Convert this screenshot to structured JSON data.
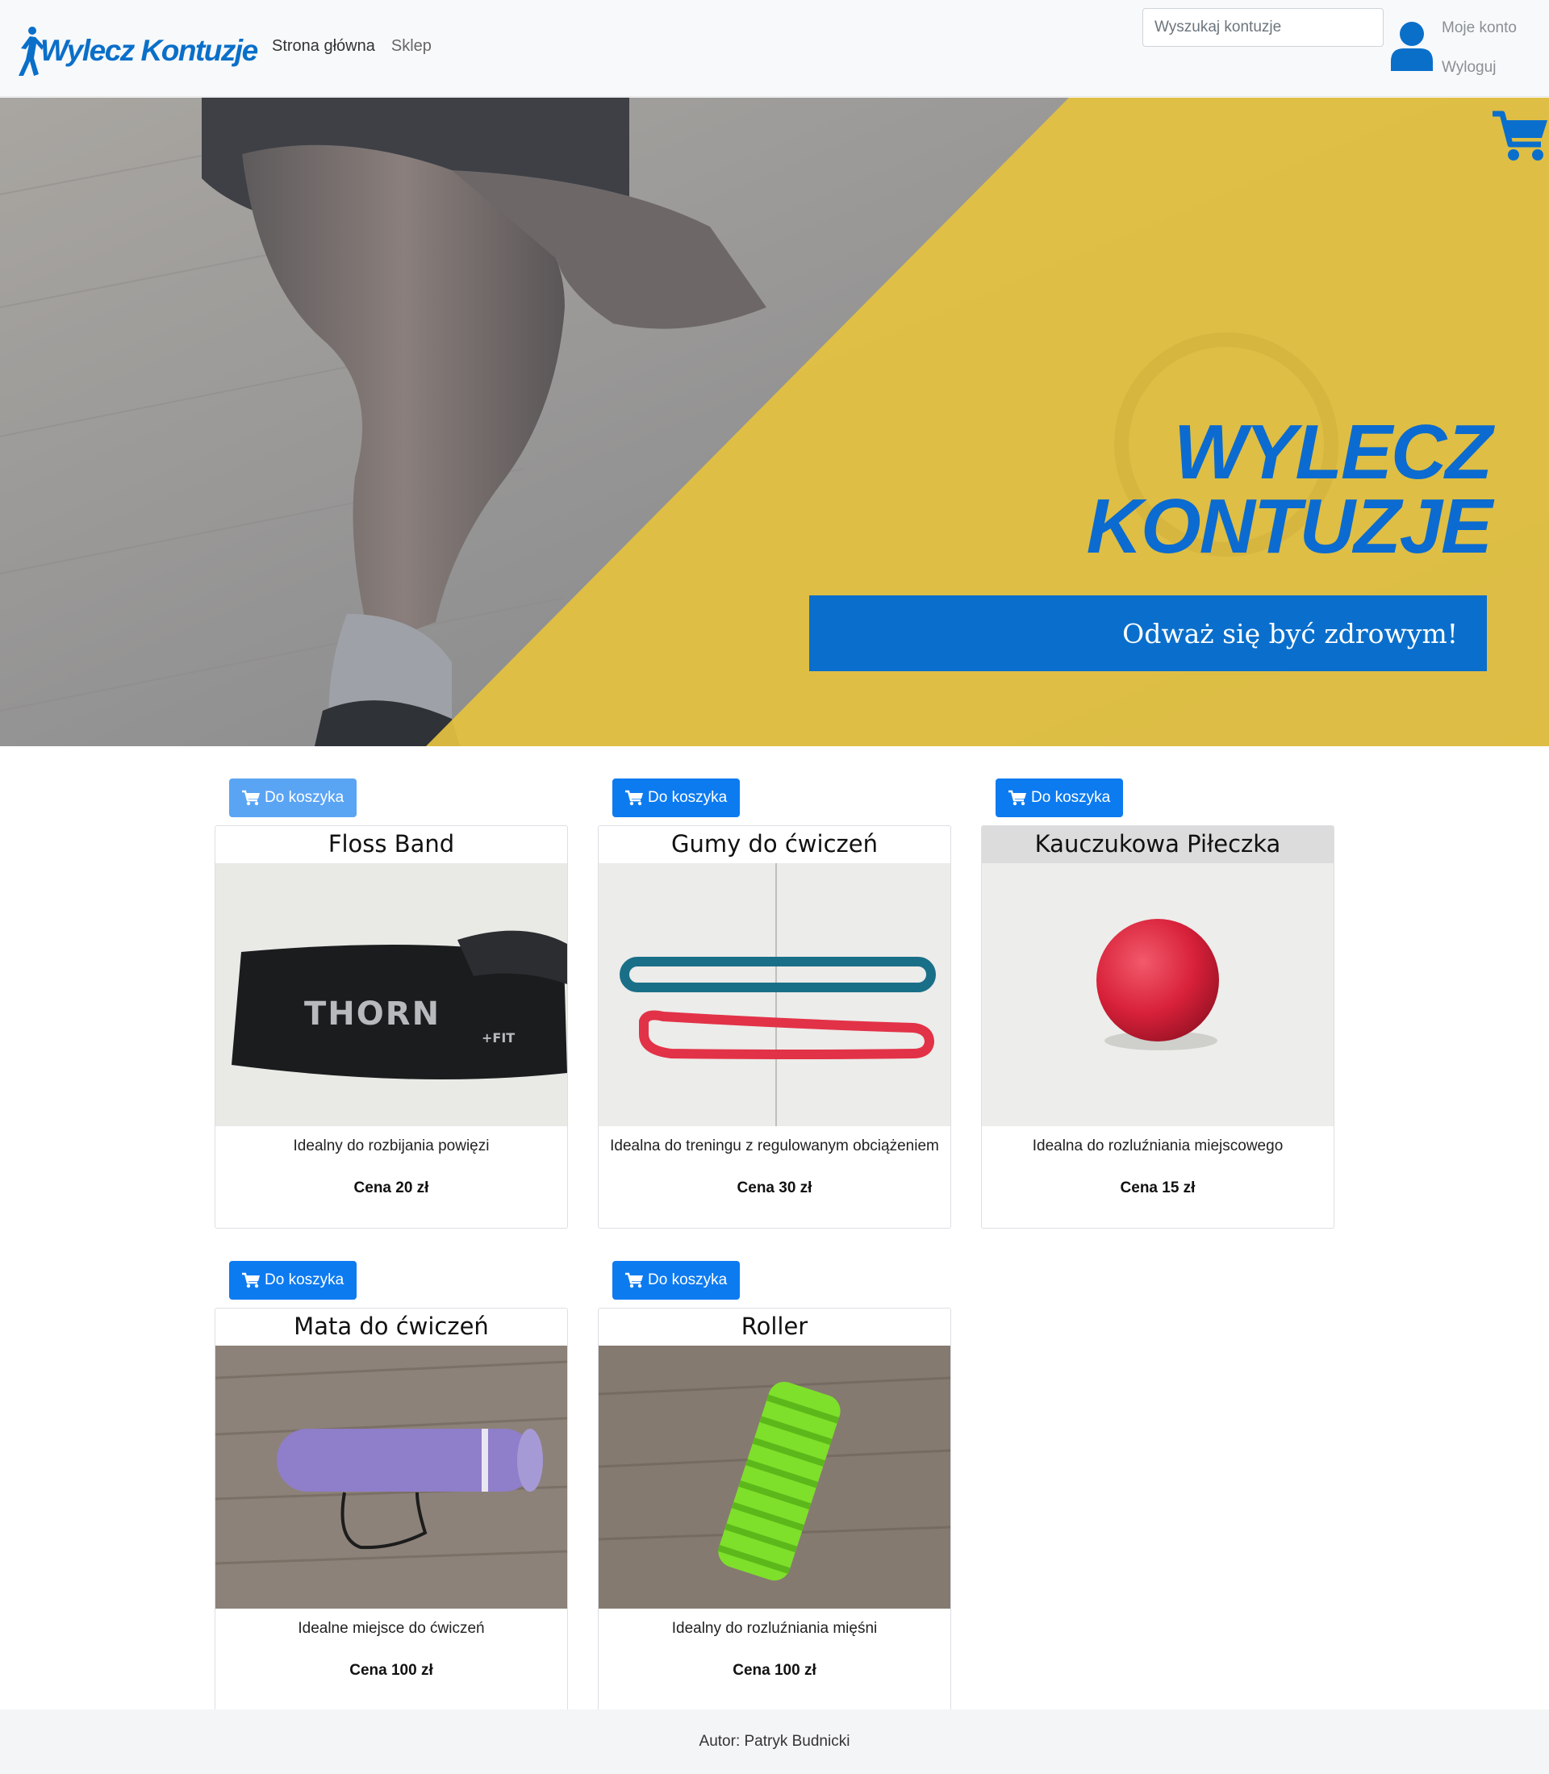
{
  "brand": {
    "name": "Wylecz Kontuzje",
    "accent": "#0a6fc9"
  },
  "nav": {
    "home": "Strona główna",
    "shop": "Sklep"
  },
  "search": {
    "placeholder": "Wyszukaj kontuzje"
  },
  "account": {
    "my_account": "Moje konto",
    "logout": "Wyloguj"
  },
  "hero": {
    "title_line1": "WYLECZ",
    "title_line2": "KONTUZJE",
    "cta": "Odważ się być zdrowym!",
    "yellow": "#e8c33d",
    "blue": "#0a6fcc"
  },
  "products": [
    {
      "add_label": "Do koszyka",
      "name": "Floss Band",
      "desc": "Idealny do rozbijania powięzi",
      "price": "Cena 20 zł"
    },
    {
      "add_label": "Do koszyka",
      "name": "Gumy do ćwiczeń",
      "desc": "Idealna do treningu z regulowanym obciążeniem",
      "price": "Cena 30 zł"
    },
    {
      "add_label": "Do koszyka",
      "name": "Kauczukowa Piłeczka",
      "desc": "Idealna do rozluźniania miejscowego",
      "price": "Cena 15 zł"
    },
    {
      "add_label": "Do koszyka",
      "name": "Mata do ćwiczeń",
      "desc": "Idealne miejsce do ćwiczeń",
      "price": "Cena 100 zł"
    },
    {
      "add_label": "Do koszyka",
      "name": "Roller",
      "desc": "Idealny do rozluźniania mięśni",
      "price": "Cena 100 zł"
    }
  ],
  "footer": {
    "text": "Autor: Patryk Budnicki"
  },
  "icons": {
    "cart": "cart-icon",
    "user": "user-icon",
    "logo_figure": "runner-icon"
  }
}
